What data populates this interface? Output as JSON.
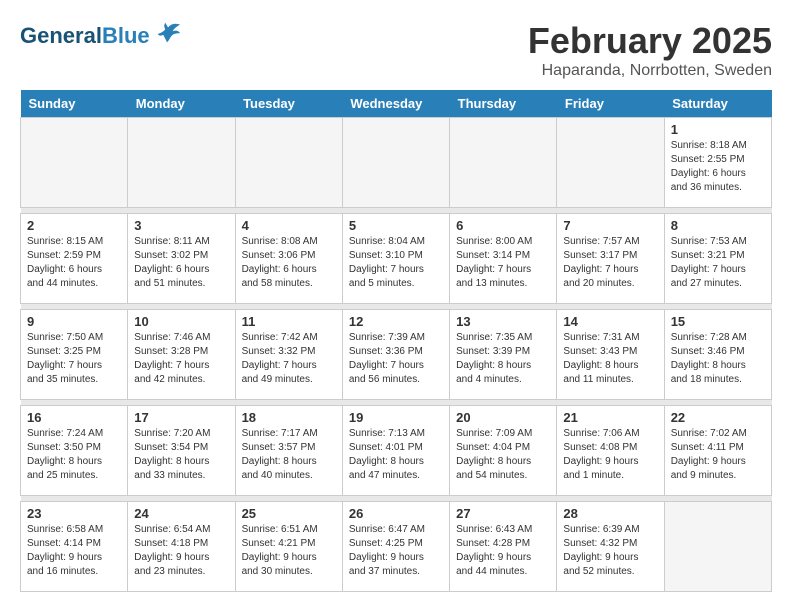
{
  "header": {
    "logo_line1": "General",
    "logo_line2": "Blue",
    "title": "February 2025",
    "subtitle": "Haparanda, Norrbotten, Sweden"
  },
  "days_of_week": [
    "Sunday",
    "Monday",
    "Tuesday",
    "Wednesday",
    "Thursday",
    "Friday",
    "Saturday"
  ],
  "weeks": [
    [
      {
        "day": "",
        "info": "",
        "empty": true
      },
      {
        "day": "",
        "info": "",
        "empty": true
      },
      {
        "day": "",
        "info": "",
        "empty": true
      },
      {
        "day": "",
        "info": "",
        "empty": true
      },
      {
        "day": "",
        "info": "",
        "empty": true
      },
      {
        "day": "",
        "info": "",
        "empty": true
      },
      {
        "day": "1",
        "info": "Sunrise: 8:18 AM\nSunset: 2:55 PM\nDaylight: 6 hours and 36 minutes.",
        "empty": false
      }
    ],
    [
      {
        "day": "2",
        "info": "Sunrise: 8:15 AM\nSunset: 2:59 PM\nDaylight: 6 hours and 44 minutes.",
        "empty": false
      },
      {
        "day": "3",
        "info": "Sunrise: 8:11 AM\nSunset: 3:02 PM\nDaylight: 6 hours and 51 minutes.",
        "empty": false
      },
      {
        "day": "4",
        "info": "Sunrise: 8:08 AM\nSunset: 3:06 PM\nDaylight: 6 hours and 58 minutes.",
        "empty": false
      },
      {
        "day": "5",
        "info": "Sunrise: 8:04 AM\nSunset: 3:10 PM\nDaylight: 7 hours and 5 minutes.",
        "empty": false
      },
      {
        "day": "6",
        "info": "Sunrise: 8:00 AM\nSunset: 3:14 PM\nDaylight: 7 hours and 13 minutes.",
        "empty": false
      },
      {
        "day": "7",
        "info": "Sunrise: 7:57 AM\nSunset: 3:17 PM\nDaylight: 7 hours and 20 minutes.",
        "empty": false
      },
      {
        "day": "8",
        "info": "Sunrise: 7:53 AM\nSunset: 3:21 PM\nDaylight: 7 hours and 27 minutes.",
        "empty": false
      }
    ],
    [
      {
        "day": "9",
        "info": "Sunrise: 7:50 AM\nSunset: 3:25 PM\nDaylight: 7 hours and 35 minutes.",
        "empty": false
      },
      {
        "day": "10",
        "info": "Sunrise: 7:46 AM\nSunset: 3:28 PM\nDaylight: 7 hours and 42 minutes.",
        "empty": false
      },
      {
        "day": "11",
        "info": "Sunrise: 7:42 AM\nSunset: 3:32 PM\nDaylight: 7 hours and 49 minutes.",
        "empty": false
      },
      {
        "day": "12",
        "info": "Sunrise: 7:39 AM\nSunset: 3:36 PM\nDaylight: 7 hours and 56 minutes.",
        "empty": false
      },
      {
        "day": "13",
        "info": "Sunrise: 7:35 AM\nSunset: 3:39 PM\nDaylight: 8 hours and 4 minutes.",
        "empty": false
      },
      {
        "day": "14",
        "info": "Sunrise: 7:31 AM\nSunset: 3:43 PM\nDaylight: 8 hours and 11 minutes.",
        "empty": false
      },
      {
        "day": "15",
        "info": "Sunrise: 7:28 AM\nSunset: 3:46 PM\nDaylight: 8 hours and 18 minutes.",
        "empty": false
      }
    ],
    [
      {
        "day": "16",
        "info": "Sunrise: 7:24 AM\nSunset: 3:50 PM\nDaylight: 8 hours and 25 minutes.",
        "empty": false
      },
      {
        "day": "17",
        "info": "Sunrise: 7:20 AM\nSunset: 3:54 PM\nDaylight: 8 hours and 33 minutes.",
        "empty": false
      },
      {
        "day": "18",
        "info": "Sunrise: 7:17 AM\nSunset: 3:57 PM\nDaylight: 8 hours and 40 minutes.",
        "empty": false
      },
      {
        "day": "19",
        "info": "Sunrise: 7:13 AM\nSunset: 4:01 PM\nDaylight: 8 hours and 47 minutes.",
        "empty": false
      },
      {
        "day": "20",
        "info": "Sunrise: 7:09 AM\nSunset: 4:04 PM\nDaylight: 8 hours and 54 minutes.",
        "empty": false
      },
      {
        "day": "21",
        "info": "Sunrise: 7:06 AM\nSunset: 4:08 PM\nDaylight: 9 hours and 1 minute.",
        "empty": false
      },
      {
        "day": "22",
        "info": "Sunrise: 7:02 AM\nSunset: 4:11 PM\nDaylight: 9 hours and 9 minutes.",
        "empty": false
      }
    ],
    [
      {
        "day": "23",
        "info": "Sunrise: 6:58 AM\nSunset: 4:14 PM\nDaylight: 9 hours and 16 minutes.",
        "empty": false
      },
      {
        "day": "24",
        "info": "Sunrise: 6:54 AM\nSunset: 4:18 PM\nDaylight: 9 hours and 23 minutes.",
        "empty": false
      },
      {
        "day": "25",
        "info": "Sunrise: 6:51 AM\nSunset: 4:21 PM\nDaylight: 9 hours and 30 minutes.",
        "empty": false
      },
      {
        "day": "26",
        "info": "Sunrise: 6:47 AM\nSunset: 4:25 PM\nDaylight: 9 hours and 37 minutes.",
        "empty": false
      },
      {
        "day": "27",
        "info": "Sunrise: 6:43 AM\nSunset: 4:28 PM\nDaylight: 9 hours and 44 minutes.",
        "empty": false
      },
      {
        "day": "28",
        "info": "Sunrise: 6:39 AM\nSunset: 4:32 PM\nDaylight: 9 hours and 52 minutes.",
        "empty": false
      },
      {
        "day": "",
        "info": "",
        "empty": true
      }
    ]
  ]
}
